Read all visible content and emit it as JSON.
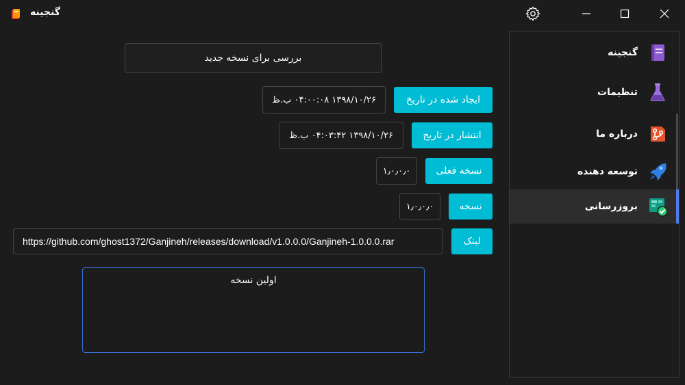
{
  "window": {
    "title": "گنجینه",
    "icons": {
      "app": "app-logo-icon",
      "settings": "gear-icon",
      "minimize": "minimize-icon",
      "maximize": "maximize-icon",
      "close": "close-icon"
    }
  },
  "sidebar": {
    "items": [
      {
        "label": "گنجینه",
        "icon": "book-icon"
      },
      {
        "label": "تنظیمات",
        "icon": "flask-icon"
      },
      {
        "label": "درباره ما",
        "icon": "git-branch-icon"
      },
      {
        "label": "توسعه دهنده",
        "icon": "rocket-icon"
      },
      {
        "label": "بروزرسانی",
        "icon": "update-check-icon"
      }
    ],
    "active_index": 4,
    "accent_color": "#4f7be8"
  },
  "main": {
    "check_button": "بررسی برای نسخه جدید",
    "created_label": "ایجاد شده در تاریخ",
    "created_value": "۱۳۹۸/۱۰/۲۶ ۰۴:۰۰:۰۸ ب.ظ",
    "published_label": "انتشار در تاریخ",
    "published_value": "۱۳۹۸/۱۰/۲۶ ۰۴:۰۳:۴۲ ب.ظ",
    "current_version_label": "نسخه فعلی",
    "current_version_value": "۱٫۰٫۰٫۰",
    "version_label": "نسخه",
    "version_value": "۱٫۰٫۰٫۰",
    "link_label": "لینک",
    "link_value": "https://github.com/ghost1372/Ganjineh/releases/download/v1.0.0.0/Ganjineh-1.0.0.0.rar",
    "release_notes": "اولین نسخه",
    "accent_color": "#00bcd4"
  }
}
